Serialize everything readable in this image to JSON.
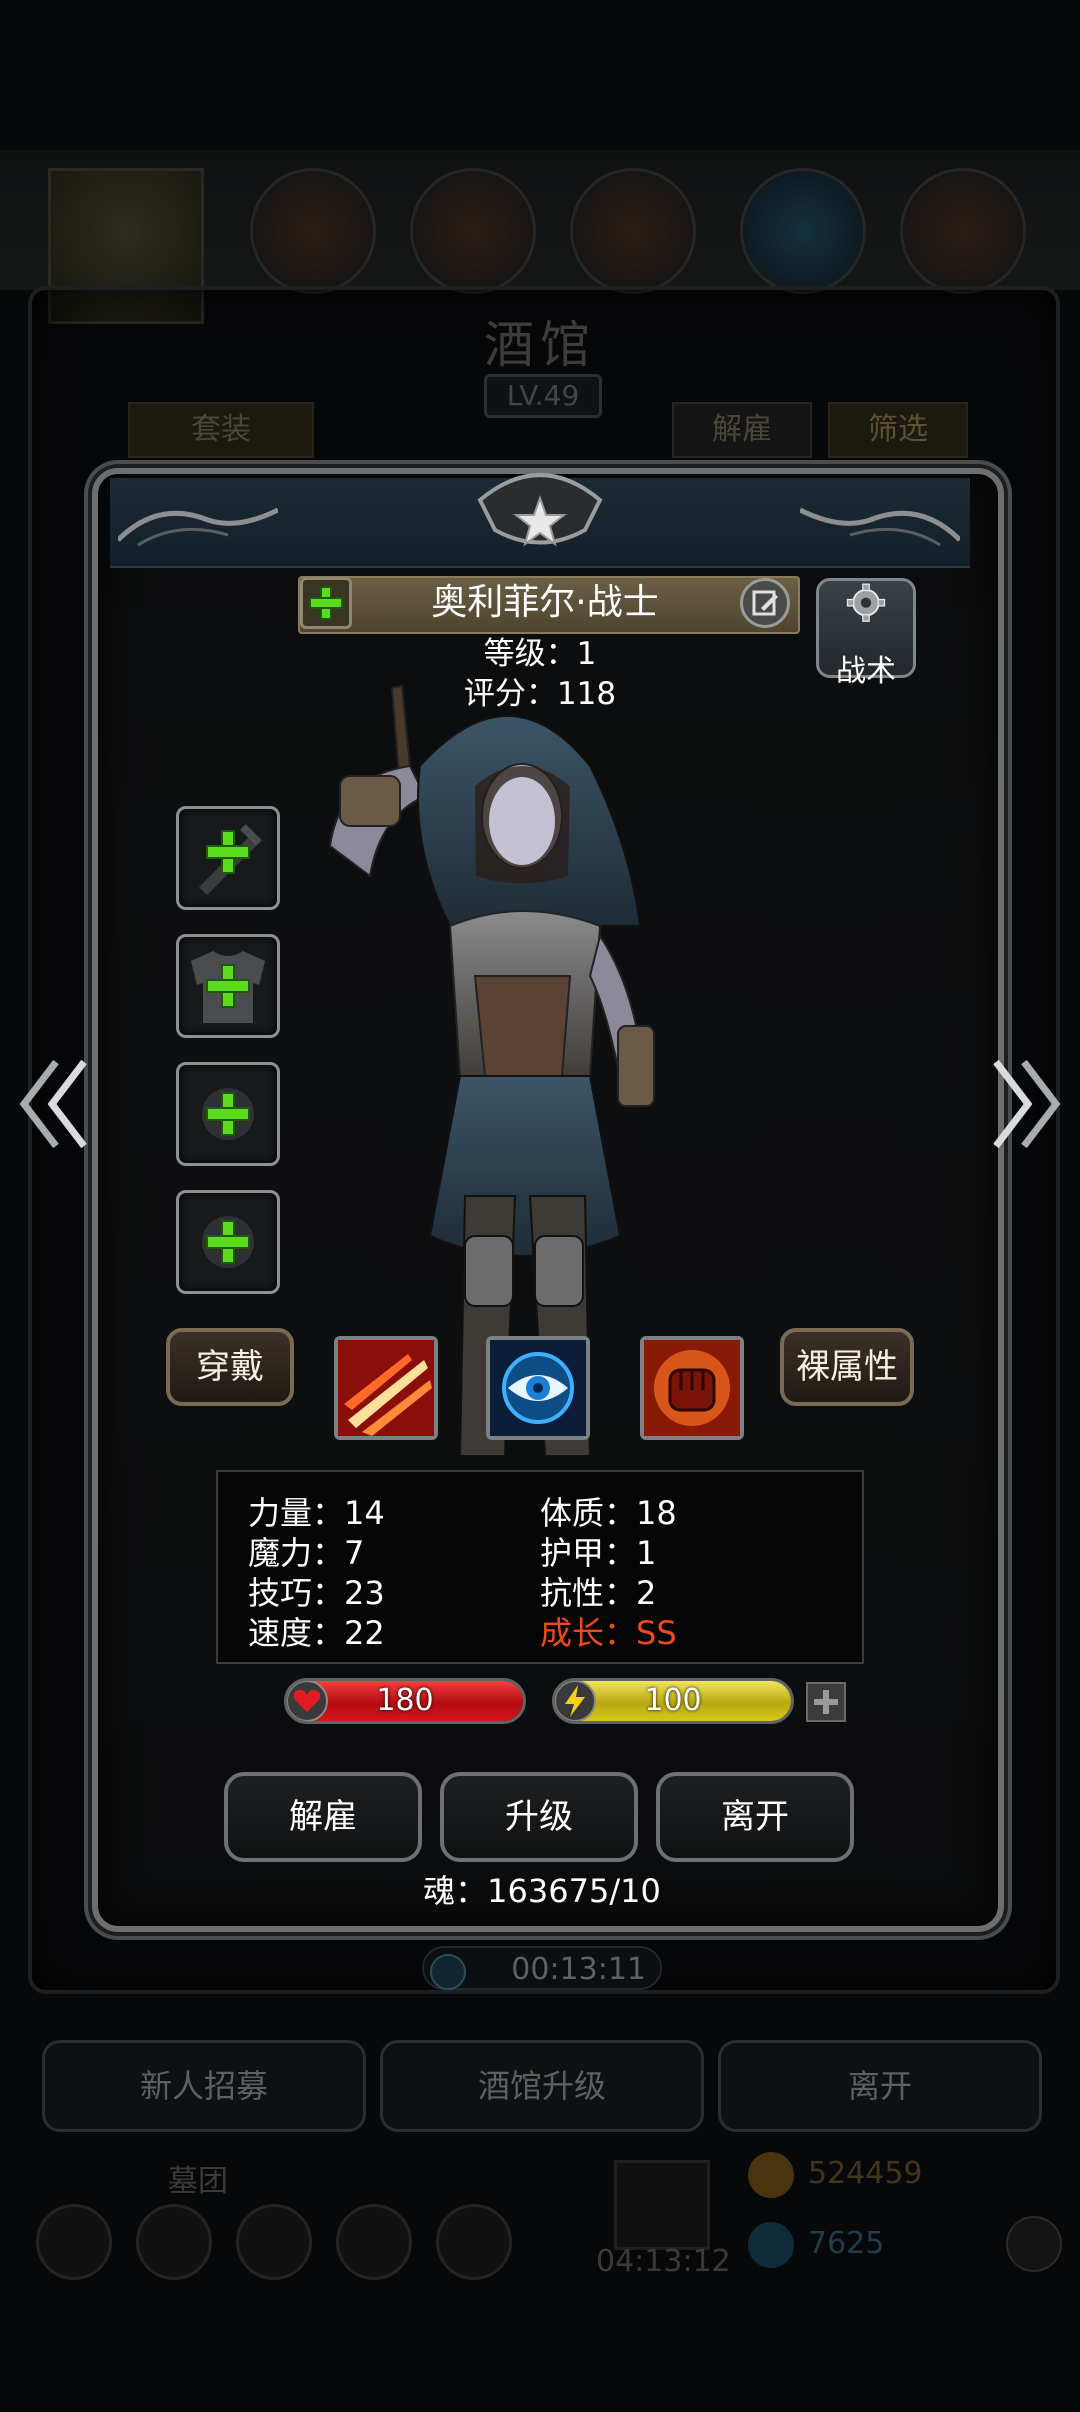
{
  "background": {
    "title": "酒馆",
    "level": "LV.49",
    "tab_set": "套装",
    "tab_dismiss": "解雇",
    "tab_filter": "筛选",
    "timer": "00:13:11",
    "bottom_recruit": "新人招募",
    "bottom_upgrade": "酒馆升级",
    "bottom_leave": "离开",
    "guild_label": "墓团",
    "gift_timer": "04:13:12",
    "gold": "524459",
    "gems": "7625"
  },
  "hero": {
    "name": "奥利菲尔·战士",
    "level_line": "等级：1",
    "score_line": "评分：118",
    "tactic_label": "战术"
  },
  "buttons": {
    "wear": "穿戴",
    "base_attr": "裸属性",
    "dismiss": "解雇",
    "upgrade": "升级",
    "leave": "离开"
  },
  "stats": {
    "strength": "力量：14",
    "magic": "魔力：7",
    "skill": "技巧：23",
    "speed": "速度：22",
    "constitution": "体质：18",
    "armor": "护甲：1",
    "resistance": "抗性：2",
    "growth": "成长：SS"
  },
  "bars": {
    "hp": "180",
    "energy": "100",
    "hp_color": "#d4161b",
    "energy_color": "#d8c81a"
  },
  "soul": "魂：163675/10",
  "icons": {
    "equip_slots": [
      "weapon-slot-icon",
      "armor-slot-icon",
      "accessory-slot-icon",
      "accessory-slot-icon"
    ],
    "skills": [
      "slash-skill-icon",
      "eye-skill-icon",
      "fist-skill-icon"
    ]
  }
}
